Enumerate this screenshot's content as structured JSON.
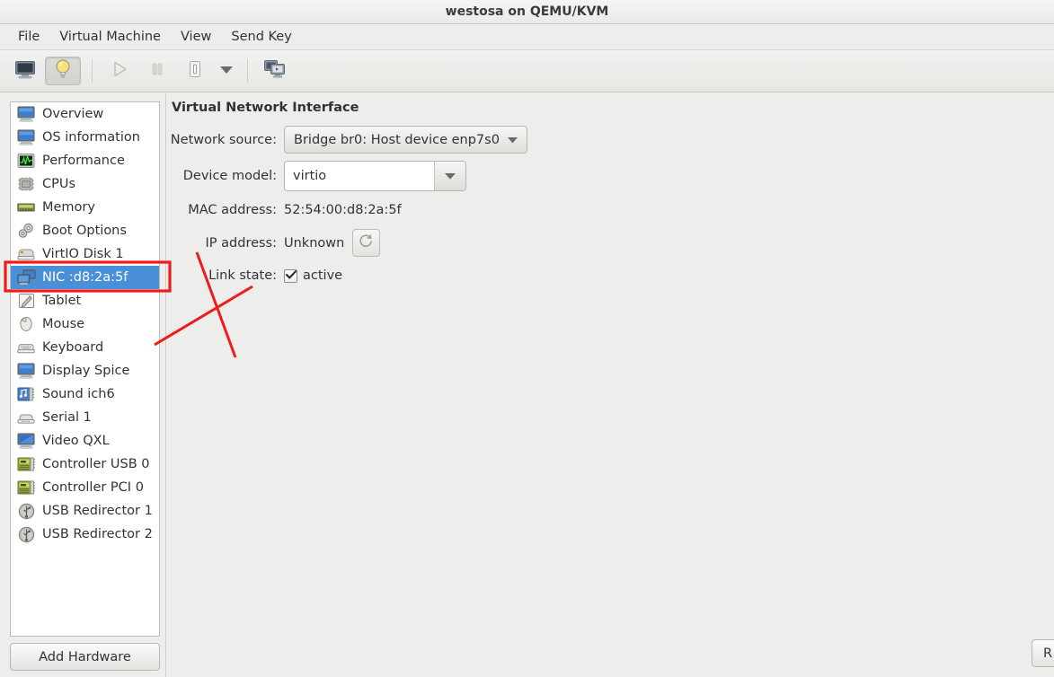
{
  "window": {
    "title": "westosa on QEMU/KVM"
  },
  "menubar": {
    "items": [
      {
        "label": "File"
      },
      {
        "label": "Virtual Machine"
      },
      {
        "label": "View"
      },
      {
        "label": "Send Key"
      }
    ]
  },
  "toolbar": {
    "buttons": [
      {
        "name": "show-console-button",
        "icon": "monitor-icon",
        "state": "normal"
      },
      {
        "name": "show-details-button",
        "icon": "lightbulb-icon",
        "state": "pressed"
      },
      {
        "name": "run-button",
        "icon": "play-icon",
        "state": "disabled"
      },
      {
        "name": "pause-button",
        "icon": "pause-icon",
        "state": "disabled"
      },
      {
        "name": "shutdown-button",
        "icon": "power-icon",
        "state": "normal"
      },
      {
        "name": "shutdown-dropdown-button",
        "icon": "chevron-down-icon",
        "state": "normal"
      },
      {
        "name": "snapshots-button",
        "icon": "screens-icon",
        "state": "normal"
      }
    ]
  },
  "sidebar": {
    "items": [
      {
        "label": "Overview",
        "icon": "monitor-icon"
      },
      {
        "label": "OS information",
        "icon": "monitor-icon"
      },
      {
        "label": "Performance",
        "icon": "graph-icon"
      },
      {
        "label": "CPUs",
        "icon": "chip-icon"
      },
      {
        "label": "Memory",
        "icon": "memory-icon"
      },
      {
        "label": "Boot Options",
        "icon": "gears-icon"
      },
      {
        "label": "VirtIO Disk 1",
        "icon": "disk-icon"
      },
      {
        "label": "NIC :d8:2a:5f",
        "icon": "nic-icon",
        "selected": true,
        "highlighted": true
      },
      {
        "label": "Tablet",
        "icon": "tablet-icon"
      },
      {
        "label": "Mouse",
        "icon": "mouse-icon"
      },
      {
        "label": "Keyboard",
        "icon": "keyboard-icon"
      },
      {
        "label": "Display Spice",
        "icon": "monitor-icon"
      },
      {
        "label": "Sound ich6",
        "icon": "sound-icon"
      },
      {
        "label": "Serial 1",
        "icon": "serial-icon"
      },
      {
        "label": "Video QXL",
        "icon": "video-icon"
      },
      {
        "label": "Controller USB 0",
        "icon": "controller-icon"
      },
      {
        "label": "Controller PCI 0",
        "icon": "controller-icon"
      },
      {
        "label": "USB Redirector 1",
        "icon": "usb-icon"
      },
      {
        "label": "USB Redirector 2",
        "icon": "usb-icon"
      }
    ],
    "add_hardware_label": "Add Hardware"
  },
  "main": {
    "pane_title": "Virtual Network Interface",
    "fields": {
      "network_source": {
        "label": "Network source:",
        "value": "Bridge br0: Host device enp7s0"
      },
      "device_model": {
        "label": "Device model:",
        "value": "virtio"
      },
      "mac_address": {
        "label": "MAC address:",
        "value": "52:54:00:d8:2a:5f"
      },
      "ip_address": {
        "label": "IP address:",
        "value": "Unknown",
        "refresh_icon": "refresh-icon"
      },
      "link_state": {
        "label": "Link state:",
        "checkbox_label": "active",
        "checked": true
      }
    }
  },
  "footer": {
    "remove_label": "R"
  },
  "annotations": {
    "highlight_color": "#ee1c1c",
    "mark_color": "#ee1c1c"
  }
}
